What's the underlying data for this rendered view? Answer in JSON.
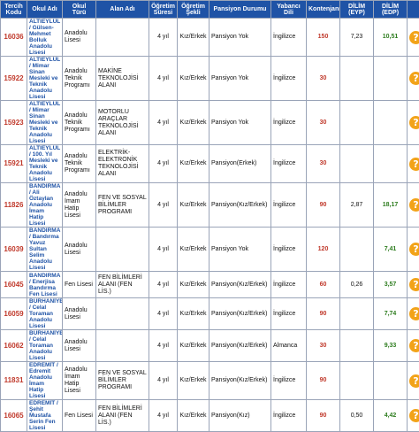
{
  "headers": [
    "Tercih Kodu",
    "Okul Adı",
    "Okul Türü",
    "Alan Adı",
    "Öğretim Süresi",
    "Öğretim Şekli",
    "Pansiyon Durumu",
    "Yabancı Dili",
    "Kontenjanı",
    "DİLİM (EYP)",
    "DİLİM (EDP)",
    ""
  ],
  "rows": [
    {
      "code": "16036",
      "school": "ALTIEYLÜL / Gülsen-Mehmet Bolluk Anadolu Lisesi",
      "type": "Anadolu Lisesi",
      "field": "",
      "duration": "4 yıl",
      "gender": "Kız/Erkek",
      "boarding": "Pansiyon Yok",
      "lang": "İngilizce",
      "quota": "150",
      "eyp": "7,23",
      "edp": "10,51"
    },
    {
      "code": "15922",
      "school": "ALTIEYLÜL / Mimar Sinan Mesleki ve Teknik Anadolu Lisesi",
      "type": "Anadolu Teknik Programı",
      "field": "MAKİNE TEKNOLOJİSİ ALANI",
      "duration": "4 yıl",
      "gender": "Kız/Erkek",
      "boarding": "Pansiyon Yok",
      "lang": "İngilizce",
      "quota": "30",
      "eyp": "",
      "edp": ""
    },
    {
      "code": "15923",
      "school": "ALTIEYLÜL / Mimar Sinan Mesleki ve Teknik Anadolu Lisesi",
      "type": "Anadolu Teknik Programı",
      "field": "MOTORLU ARAÇLAR TEKNOLOJİSİ ALANI",
      "duration": "4 yıl",
      "gender": "Kız/Erkek",
      "boarding": "Pansiyon Yok",
      "lang": "İngilizce",
      "quota": "30",
      "eyp": "",
      "edp": ""
    },
    {
      "code": "15921",
      "school": "ALTIEYLÜL / 100. Yıl Mesleki ve Teknik Anadolu Lisesi",
      "type": "Anadolu Teknik Programı",
      "field": "ELEKTRİK-ELEKTRONİK TEKNOLOJİSİ ALANI",
      "duration": "4 yıl",
      "gender": "Kız/Erkek",
      "boarding": "Pansiyon(Erkek)",
      "lang": "İngilizce",
      "quota": "30",
      "eyp": "",
      "edp": ""
    },
    {
      "code": "11826",
      "school": "BANDIRMA / Ali Öztaylan Anadolu İmam Hatip Lisesi",
      "type": "Anadolu İmam Hatip Lisesi",
      "field": "FEN VE SOSYAL BİLİMLER PROGRAMI",
      "duration": "4 yıl",
      "gender": "Kız/Erkek",
      "boarding": "Pansiyon(Kız/Erkek)",
      "lang": "İngilizce",
      "quota": "90",
      "eyp": "2,87",
      "edp": "18,17"
    },
    {
      "code": "16039",
      "school": "BANDIRMA / Bandırma Yavuz Sultan Selim Anadolu Lisesi",
      "type": "Anadolu Lisesi",
      "field": "",
      "duration": "4 yıl",
      "gender": "Kız/Erkek",
      "boarding": "Pansiyon Yok",
      "lang": "İngilizce",
      "quota": "120",
      "eyp": "",
      "edp": "7,41"
    },
    {
      "code": "16045",
      "school": "BANDIRMA / Enerjisa Bandırma Fen Lisesi",
      "type": "Fen Lisesi",
      "field": "FEN BİLİMLERİ ALANI (FEN LİS.)",
      "duration": "4 yıl",
      "gender": "Kız/Erkek",
      "boarding": "Pansiyon(Kız/Erkek)",
      "lang": "İngilizce",
      "quota": "60",
      "eyp": "0,26",
      "edp": "3,57"
    },
    {
      "code": "16059",
      "school": "BURHANİYE / Celal Toraman Anadolu Lisesi",
      "type": "Anadolu Lisesi",
      "field": "",
      "duration": "4 yıl",
      "gender": "Kız/Erkek",
      "boarding": "Pansiyon(Kız/Erkek)",
      "lang": "İngilizce",
      "quota": "90",
      "eyp": "",
      "edp": "7,74"
    },
    {
      "code": "16062",
      "school": "BURHANİYE / Celal Toraman Anadolu Lisesi",
      "type": "Anadolu Lisesi",
      "field": "",
      "duration": "4 yıl",
      "gender": "Kız/Erkek",
      "boarding": "Pansiyon(Kız/Erkek)",
      "lang": "Almanca",
      "quota": "30",
      "eyp": "",
      "edp": "9,33"
    },
    {
      "code": "11831",
      "school": "EDREMİT / Edremit Anadolu İmam Hatip Lisesi",
      "type": "Anadolu İmam Hatip Lisesi",
      "field": "FEN VE SOSYAL BİLİMLER PROGRAMI",
      "duration": "4 yıl",
      "gender": "Kız/Erkek",
      "boarding": "Pansiyon(Kız/Erkek)",
      "lang": "İngilizce",
      "quota": "90",
      "eyp": "",
      "edp": ""
    },
    {
      "code": "16065",
      "school": "EDREMİT / Şehit Mustafa Serin Fen Lisesi",
      "type": "Fen Lisesi",
      "field": "FEN BİLİMLERİ ALANI (FEN LİS.)",
      "duration": "4 yıl",
      "gender": "Kız/Erkek",
      "boarding": "Pansiyon(Kız)",
      "lang": "İngilizce",
      "quota": "90",
      "eyp": "0,50",
      "edp": "4,42"
    }
  ],
  "help_glyph": "?"
}
